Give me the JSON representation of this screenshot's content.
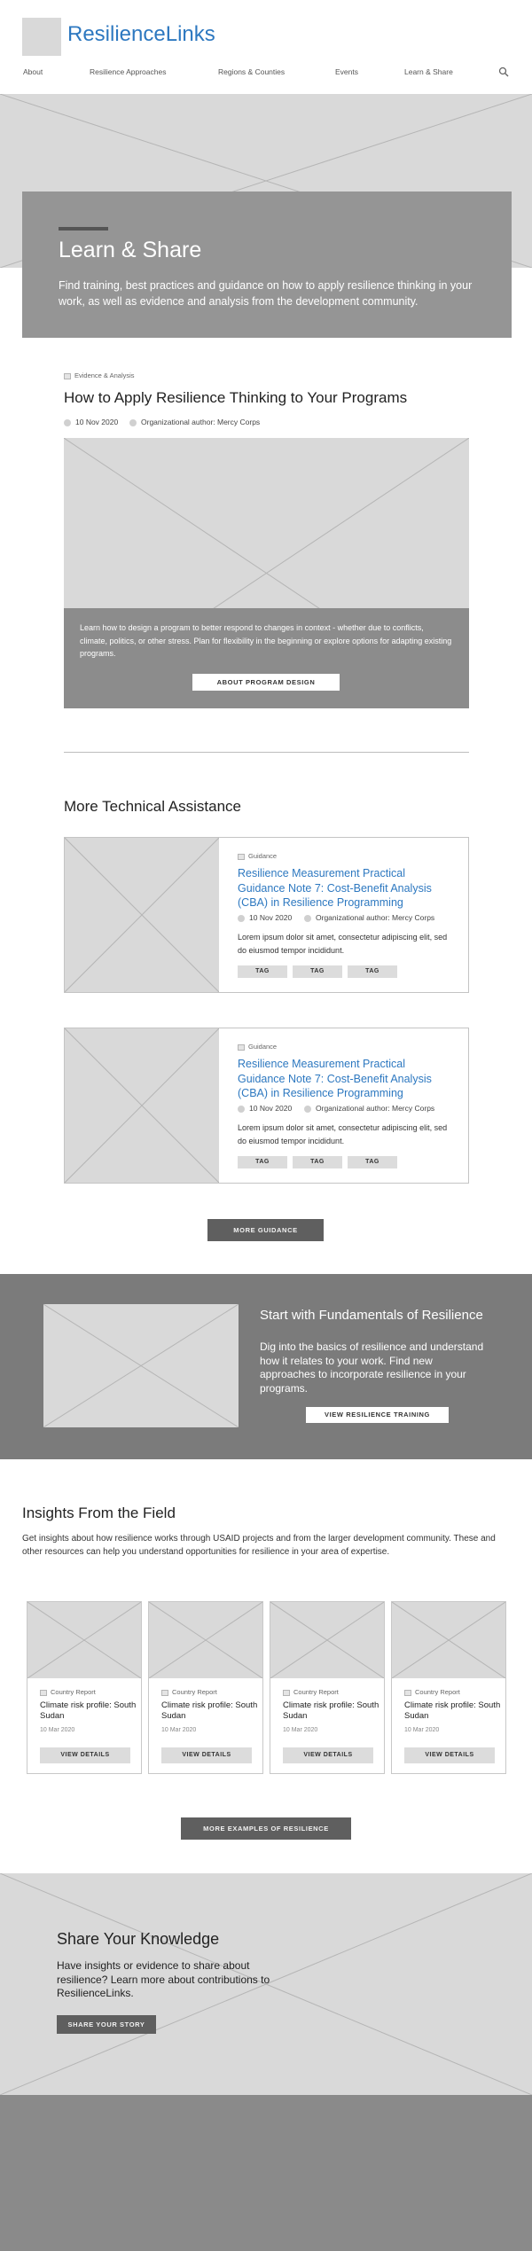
{
  "site": {
    "name": "ResilienceLinks"
  },
  "nav": {
    "about": "About",
    "approaches": "Resilience Approaches",
    "regions": "Regions & Counties",
    "events": "Events",
    "learn": "Learn & Share"
  },
  "hero": {
    "title": "Learn & Share",
    "text": "Find training, best practices and guidance on how to apply resilience thinking in your work, as well as evidence and analysis from the development community."
  },
  "featured": {
    "tag": "Evidence & Analysis",
    "title": "How to Apply Resilience Thinking to Your Programs",
    "date": "10 Nov 2020",
    "author": "Organizational author: Mercy Corps",
    "overlay_text": "Learn how to design a program to better respond to changes in context - whether due to conflicts, climate, politics, or other stress. Plan for flexibility in the beginning or explore options for adapting existing programs.",
    "button": "ABOUT PROGRAM DESIGN"
  },
  "technical": {
    "heading": "More Technical Assistance",
    "cards": [
      {
        "tag": "Guidance",
        "title": "Resilience Measurement Practical Guidance Note 7: Cost-Benefit Analysis (CBA) in Resilience Programming",
        "date": "10 Nov 2020",
        "author": "Organizational author: Mercy Corps",
        "text": "Lorem ipsum dolor sit amet, consectetur adipiscing elit, sed do eiusmod tempor incididunt.",
        "tags": [
          "TAG",
          "TAG",
          "TAG"
        ]
      },
      {
        "tag": "Guidance",
        "title": "Resilience Measurement Practical Guidance Note 7: Cost-Benefit Analysis (CBA) in Resilience Programming",
        "date": "10 Nov 2020",
        "author": "Organizational author: Mercy Corps",
        "text": "Lorem ipsum dolor sit amet, consectetur adipiscing elit, sed do eiusmod tempor incididunt.",
        "tags": [
          "TAG",
          "TAG",
          "TAG"
        ]
      }
    ],
    "more_button": "MORE GUIDANCE"
  },
  "fundamentals": {
    "title": "Start with Fundamentals of Resilience",
    "text": "Dig into the basics of resilience and understand how it relates to your work. Find new approaches to incorporate resilience in your programs.",
    "button": "VIEW RESILIENCE TRAINING"
  },
  "insights": {
    "heading": "Insights From the Field",
    "text": "Get insights about how resilience works through USAID projects and from the larger development community. These and other resources can help you understand opportunities for resilience in your area of expertise.",
    "cards": [
      {
        "tag": "Country Report",
        "title": "Climate risk profile: South Sudan",
        "date": "10 Mar 2020",
        "button": "VIEW DETAILS"
      },
      {
        "tag": "Country Report",
        "title": "Climate risk profile: South Sudan",
        "date": "10 Mar 2020",
        "button": "VIEW DETAILS"
      },
      {
        "tag": "Country Report",
        "title": "Climate risk profile: South Sudan",
        "date": "10 Mar 2020",
        "button": "VIEW DETAILS"
      },
      {
        "tag": "Country Report",
        "title": "Climate risk profile: South Sudan",
        "date": "10 Mar 2020",
        "button": "VIEW DETAILS"
      }
    ],
    "more_button": "MORE EXAMPLES OF RESILIENCE"
  },
  "share": {
    "title": "Share Your Knowledge",
    "text": "Have insights or evidence to share about resilience? Learn more about contributions to ResilienceLinks.",
    "button": "SHARE YOUR STORY"
  },
  "colors": {
    "brand": "#2d78c0",
    "hero_panel": "#959595",
    "fundamentals_bg": "#7b7b7b",
    "footer_bg": "#8a8a8a",
    "button_dark": "#5f5f5f"
  },
  "icons": {
    "search": "search-icon",
    "tag": "tag-icon",
    "date": "calendar-icon",
    "author": "user-icon"
  }
}
